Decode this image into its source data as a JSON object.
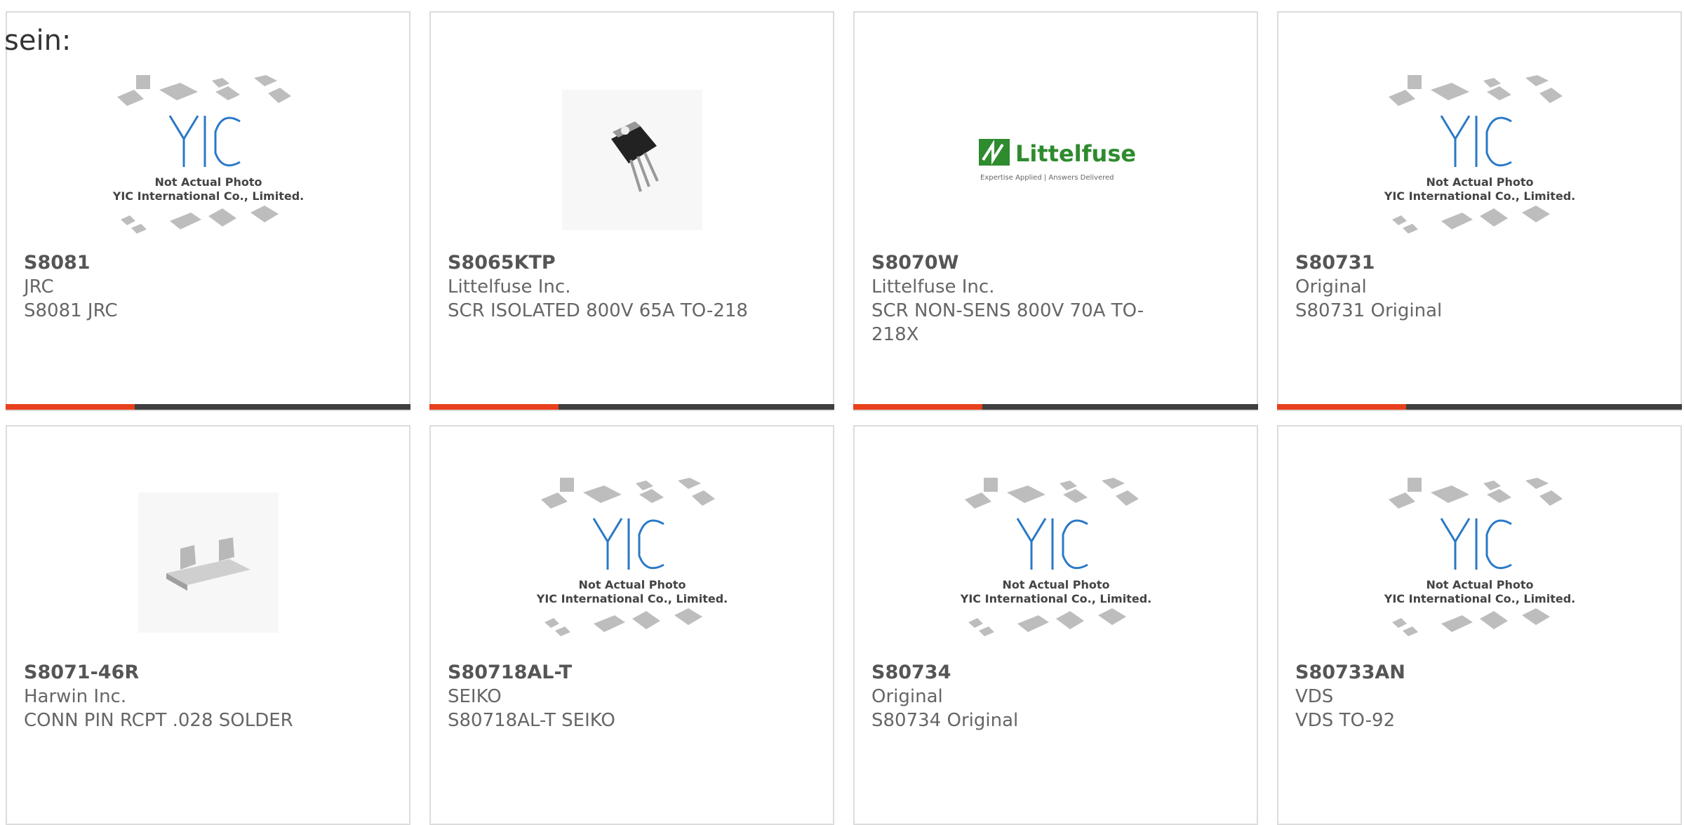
{
  "lead_text": "sein:",
  "placeholder": {
    "line1": "Not Actual Photo",
    "line2": "YIC International Co., Limited.",
    "logo": "YIC",
    "chip_color": "#bdbdbd",
    "logo_color": "#2a79c7"
  },
  "littelfuse": {
    "brand": "Littelfuse",
    "tagline": "Expertise Applied | Answers Delivered",
    "brand_color": "#2e8b2e"
  },
  "accent_color": "#e8401c",
  "bar_color": "#3f3f3f",
  "products": [
    {
      "pn": "S8081",
      "maker": "JRC",
      "desc": "S8081 JRC"
    },
    {
      "pn": "S8065KTP",
      "maker": "Littelfuse Inc.",
      "desc": "SCR ISOLATED 800V 65A TO-218"
    },
    {
      "pn": "S8070W",
      "maker": "Littelfuse Inc.",
      "desc": "SCR NON-SENS 800V 70A TO-218X"
    },
    {
      "pn": "S80731",
      "maker": "Original",
      "desc": "S80731 Original"
    },
    {
      "pn": "S8071-46R",
      "maker": "Harwin Inc.",
      "desc": "CONN PIN RCPT .028 SOLDER"
    },
    {
      "pn": "S80718AL-T",
      "maker": "SEIKO",
      "desc": "S80718AL-T SEIKO"
    },
    {
      "pn": "S80734",
      "maker": "Original",
      "desc": "S80734 Original"
    },
    {
      "pn": "S80733AN",
      "maker": "VDS",
      "desc": "VDS TO-92"
    }
  ]
}
